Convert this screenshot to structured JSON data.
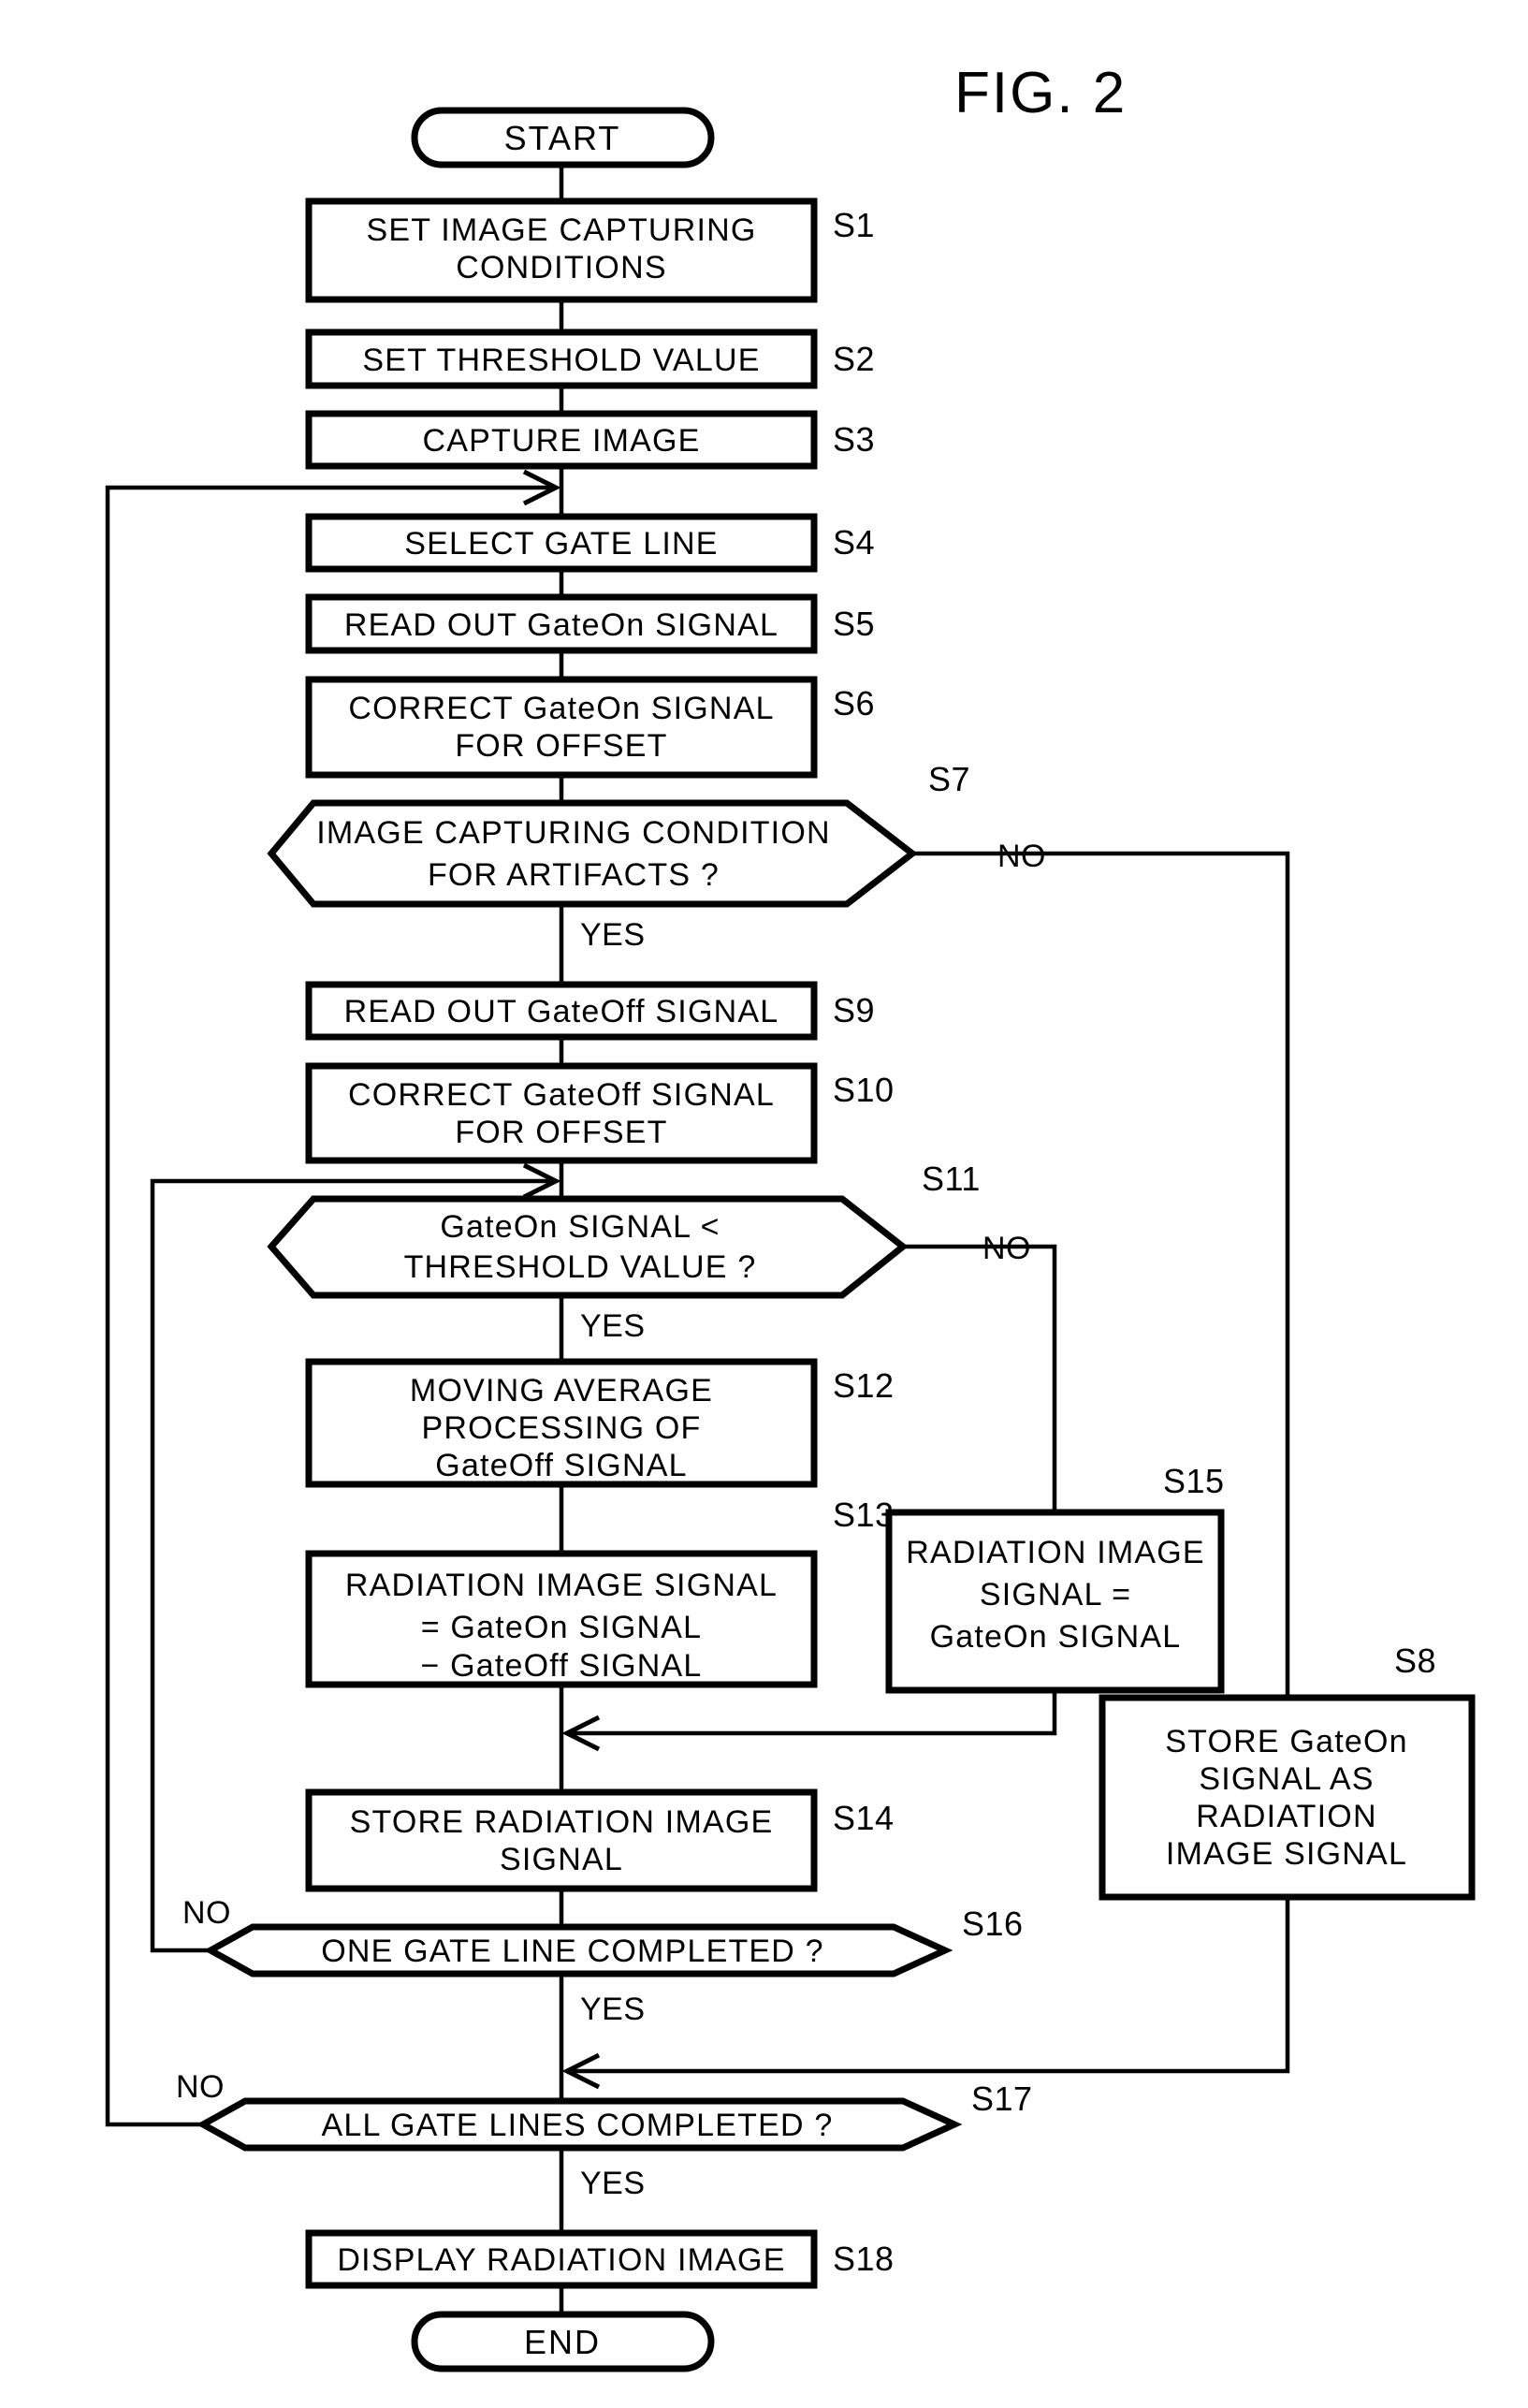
{
  "figure": {
    "title": "FIG. 2",
    "type": "flowchart"
  },
  "terminals": {
    "start": "START",
    "end": "END"
  },
  "branch_labels": {
    "yes": "YES",
    "no": "NO"
  },
  "steps": [
    {
      "id": "S1",
      "shape": "process",
      "lines": [
        "SET IMAGE CAPTURING",
        "CONDITIONS"
      ],
      "line1": "SET IMAGE CAPTURING",
      "line2": "CONDITIONS"
    },
    {
      "id": "S2",
      "shape": "process",
      "line1": "SET THRESHOLD VALUE"
    },
    {
      "id": "S3",
      "shape": "process",
      "line1": "CAPTURE IMAGE"
    },
    {
      "id": "S4",
      "shape": "process",
      "line1": "SELECT GATE LINE"
    },
    {
      "id": "S5",
      "shape": "process",
      "line1": "READ OUT GateOn SIGNAL"
    },
    {
      "id": "S6",
      "shape": "process",
      "line1": "CORRECT GateOn SIGNAL",
      "line2": "FOR OFFSET"
    },
    {
      "id": "S7",
      "shape": "decision",
      "line1": "IMAGE CAPTURING CONDITION",
      "line2": "FOR ARTIFACTS ?",
      "yes_label": "YES",
      "no_label": "NO"
    },
    {
      "id": "S8",
      "shape": "process",
      "line1": "STORE GateOn",
      "line2": "SIGNAL AS",
      "line3": "RADIATION",
      "line4": "IMAGE SIGNAL"
    },
    {
      "id": "S9",
      "shape": "process",
      "line1": "READ OUT GateOff SIGNAL"
    },
    {
      "id": "S10",
      "shape": "process",
      "line1": "CORRECT GateOff SIGNAL",
      "line2": "FOR OFFSET"
    },
    {
      "id": "S11",
      "shape": "decision",
      "line1": "GateOn SIGNAL <",
      "line2": "THRESHOLD VALUE ?",
      "yes_label": "YES",
      "no_label": "NO"
    },
    {
      "id": "S12",
      "shape": "process",
      "line1": "MOVING AVERAGE",
      "line2": "PROCESSING OF",
      "line3": "GateOff SIGNAL"
    },
    {
      "id": "S13",
      "shape": "process",
      "line1": "RADIATION IMAGE SIGNAL",
      "line2": "= GateOn SIGNAL",
      "line3": "− GateOff SIGNAL"
    },
    {
      "id": "S14",
      "shape": "process",
      "line1": "STORE RADIATION IMAGE",
      "line2": "SIGNAL"
    },
    {
      "id": "S15",
      "shape": "process",
      "line1": "RADIATION IMAGE",
      "line2": "SIGNAL =",
      "line3": "GateOn SIGNAL"
    },
    {
      "id": "S16",
      "shape": "decision",
      "line1": "ONE GATE LINE COMPLETED ?",
      "yes_label": "YES",
      "no_label": "NO"
    },
    {
      "id": "S17",
      "shape": "decision",
      "line1": "ALL GATE LINES COMPLETED ?",
      "yes_label": "YES",
      "no_label": "NO"
    },
    {
      "id": "S18",
      "shape": "process",
      "line1": "DISPLAY RADIATION IMAGE"
    }
  ],
  "colors": {
    "stroke": "#000000",
    "fill": "#ffffff",
    "background": "#ffffff"
  }
}
